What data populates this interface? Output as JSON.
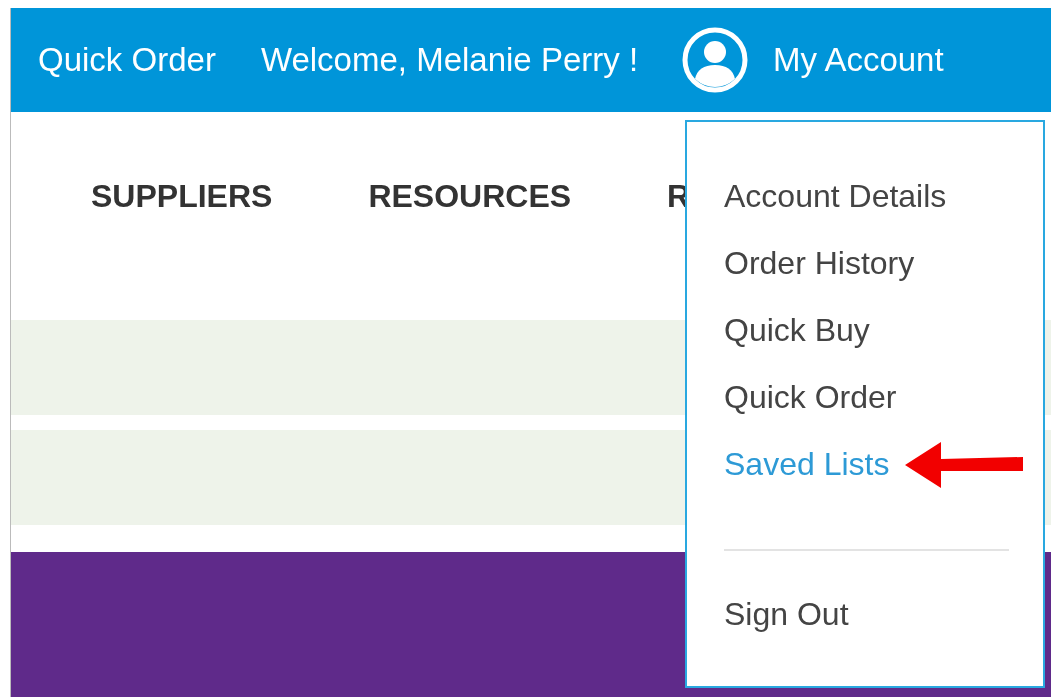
{
  "top_bar": {
    "quick_order": "Quick Order",
    "welcome": "Welcome, Melanie Perry !",
    "account": "My Account"
  },
  "nav": {
    "items": [
      "SUPPLIERS",
      "RESOURCES",
      "R"
    ]
  },
  "account_menu": {
    "items": [
      {
        "label": "Account Details",
        "selected": false,
        "arrow": false
      },
      {
        "label": "Order History",
        "selected": false,
        "arrow": false
      },
      {
        "label": "Quick Buy",
        "selected": false,
        "arrow": false
      },
      {
        "label": "Quick Order",
        "selected": false,
        "arrow": false
      },
      {
        "label": "Saved Lists",
        "selected": true,
        "arrow": true
      }
    ],
    "sign_out": "Sign Out"
  }
}
